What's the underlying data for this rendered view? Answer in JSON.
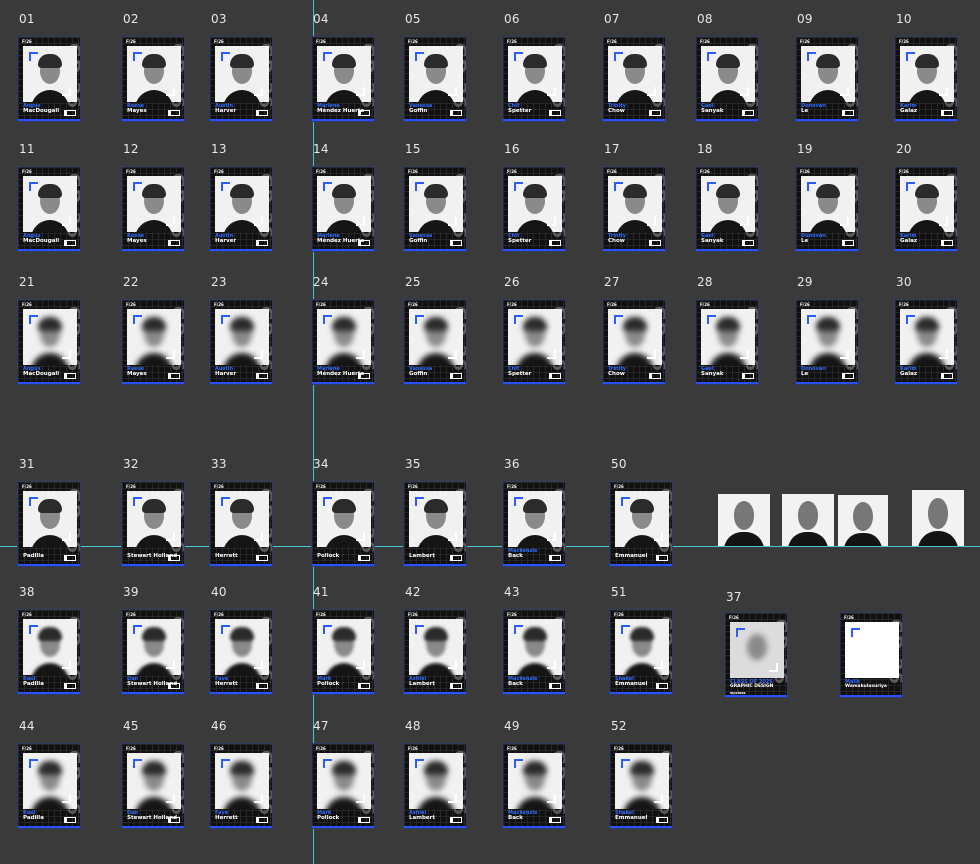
{
  "tiles": [
    {
      "num": "01",
      "first": "Angus",
      "last": "MacDougall",
      "tag": "F/26"
    },
    {
      "num": "02",
      "first": "Reese",
      "last": "Mayes",
      "tag": "F/26"
    },
    {
      "num": "03",
      "first": "Austin",
      "last": "Harver",
      "tag": "F/26"
    },
    {
      "num": "04",
      "first": "Marlene",
      "last": "Méndez Huerta",
      "tag": "F/26"
    },
    {
      "num": "05",
      "first": "Vanessa",
      "last": "Goffin",
      "tag": "F/26"
    },
    {
      "num": "06",
      "first": "Chit",
      "last": "Spetter",
      "tag": "F/26"
    },
    {
      "num": "07",
      "first": "Trinity",
      "last": "Chow",
      "tag": "F/26"
    },
    {
      "num": "08",
      "first": "Gael",
      "last": "Sanyak",
      "tag": "F/26"
    },
    {
      "num": "09",
      "first": "Donovan",
      "last": "Le",
      "tag": "F/26"
    },
    {
      "num": "10",
      "first": "Karim",
      "last": "Galaz",
      "tag": "F/26"
    },
    {
      "num": "11",
      "first": "Angus",
      "last": "MacDougall",
      "tag": "F/26"
    },
    {
      "num": "12",
      "first": "Reese",
      "last": "Mayes",
      "tag": "F/26"
    },
    {
      "num": "13",
      "first": "Austin",
      "last": "Harver",
      "tag": "F/26"
    },
    {
      "num": "14",
      "first": "Marlene",
      "last": "Méndez Huerta",
      "tag": "F/26"
    },
    {
      "num": "15",
      "first": "Vanessa",
      "last": "Goffin",
      "tag": "F/26"
    },
    {
      "num": "16",
      "first": "Chit",
      "last": "Spetter",
      "tag": "F/26"
    },
    {
      "num": "17",
      "first": "Trinity",
      "last": "Chow",
      "tag": "F/26"
    },
    {
      "num": "18",
      "first": "Gael",
      "last": "Sanyak",
      "tag": "F/26"
    },
    {
      "num": "19",
      "first": "Donovan",
      "last": "Le",
      "tag": "F/26"
    },
    {
      "num": "20",
      "first": "Karim",
      "last": "Galaz",
      "tag": "F/26"
    },
    {
      "num": "21",
      "first": "Angus",
      "last": "MacDougall",
      "tag": "F/26"
    },
    {
      "num": "22",
      "first": "Reese",
      "last": "Mayes",
      "tag": "F/26"
    },
    {
      "num": "23",
      "first": "Austin",
      "last": "Harver",
      "tag": "F/26"
    },
    {
      "num": "24",
      "first": "Marlene",
      "last": "Méndez Huerta",
      "tag": "F/26"
    },
    {
      "num": "25",
      "first": "Vanessa",
      "last": "Goffin",
      "tag": "F/26"
    },
    {
      "num": "26",
      "first": "Chit",
      "last": "Spetter",
      "tag": "F/26"
    },
    {
      "num": "27",
      "first": "Trinity",
      "last": "Chow",
      "tag": "F/26"
    },
    {
      "num": "28",
      "first": "Gael",
      "last": "Sanyak",
      "tag": "F/26"
    },
    {
      "num": "29",
      "first": "Donovan",
      "last": "Le",
      "tag": "F/26"
    },
    {
      "num": "30",
      "first": "Karim",
      "last": "Galaz",
      "tag": "F/26"
    },
    {
      "num": "31",
      "first": "",
      "last": "Padilla",
      "tag": "F/26"
    },
    {
      "num": "32",
      "first": "",
      "last": "Stewart Holland",
      "tag": "F/26"
    },
    {
      "num": "33",
      "first": "",
      "last": "Herrett",
      "tag": "F/26"
    },
    {
      "num": "34",
      "first": "",
      "last": "Pollock",
      "tag": "F/26"
    },
    {
      "num": "35",
      "first": "",
      "last": "Lambert",
      "tag": "F/26"
    },
    {
      "num": "36",
      "first": "Mackenzie",
      "last": "Back",
      "tag": "F/26"
    },
    {
      "num": "50",
      "first": "",
      "last": "Emmanuel",
      "tag": "F/26"
    },
    {
      "num": "38",
      "first": "Raúl",
      "last": "Padilla",
      "tag": "F/26"
    },
    {
      "num": "39",
      "first": "Dan",
      "last": "Stewart Holland",
      "tag": "F/26"
    },
    {
      "num": "40",
      "first": "Fave",
      "last": "Herrett",
      "tag": "F/26"
    },
    {
      "num": "41",
      "first": "Mark",
      "last": "Pollock",
      "tag": "F/26"
    },
    {
      "num": "42",
      "first": "Ashlei",
      "last": "Lambert",
      "tag": "F/26"
    },
    {
      "num": "43",
      "first": "Mackenzie",
      "last": "Back",
      "tag": "F/26"
    },
    {
      "num": "51",
      "first": "Shakel",
      "last": "Emmanuel",
      "tag": "F/26"
    },
    {
      "num": "44",
      "first": "Raúl",
      "last": "Padilla",
      "tag": "F/26"
    },
    {
      "num": "45",
      "first": "Dan",
      "last": "Stewart Holland",
      "tag": "F/26"
    },
    {
      "num": "46",
      "first": "Fave",
      "last": "Herrett",
      "tag": "F/26"
    },
    {
      "num": "47",
      "first": "Mark",
      "last": "Pollock",
      "tag": "F/26"
    },
    {
      "num": "48",
      "first": "Ashlei",
      "last": "Lambert",
      "tag": "F/26"
    },
    {
      "num": "49",
      "first": "Mackenzie",
      "last": "Back",
      "tag": "F/26"
    },
    {
      "num": "52",
      "first": "Shakel",
      "last": "Emmanuel",
      "tag": "F/26"
    }
  ],
  "special": [
    {
      "num": "37",
      "line1": "CLASS OF 2026",
      "line2": "GRAPHIC DESIGN",
      "line3": "wpclass",
      "tag": "F/26"
    },
    {
      "num": "",
      "first": "Malik",
      "last": "Wamakulasuriya",
      "tag": "F/26"
    }
  ],
  "gd_mark": "GD 26",
  "colors": {
    "background": "#3a3a3a",
    "accent_blue": "#2f6cff",
    "guide": "#46c4d6"
  }
}
